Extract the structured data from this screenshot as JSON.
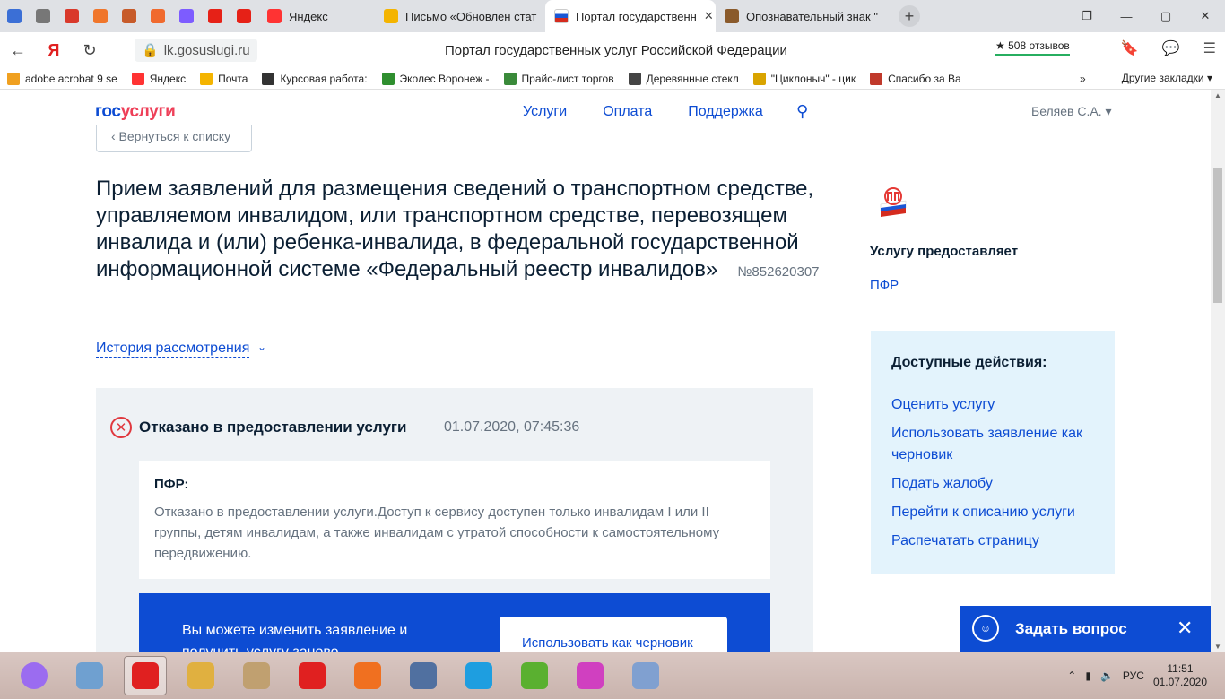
{
  "browser": {
    "tabs": [
      {
        "label": "Яндекс",
        "color": "#ff3333"
      },
      {
        "label": "Письмо «Обновлен стат",
        "color": "#f4b400"
      },
      {
        "label": "Портал государственн",
        "color": "#1a57d6",
        "active": true
      },
      {
        "label": "Опознавательный знак \"",
        "color": "#8a5a2b"
      }
    ],
    "pinned_colors": [
      "#3b6fd6",
      "#777777",
      "#d9392b",
      "#f0762b",
      "#c75b2a",
      "#f06a2e",
      "#7d5cff",
      "#e62117",
      "#e62117"
    ],
    "url": "lk.gosuslugi.ru",
    "page_title": "Портал государственных услуг Российской Федерации",
    "reviews": "★ 508 отзывов",
    "bookmarks": [
      {
        "label": "adobe acrobat 9 se",
        "color": "#f0a020"
      },
      {
        "label": "Яндекс",
        "color": "#ff3333"
      },
      {
        "label": "Почта",
        "color": "#f4b400"
      },
      {
        "label": "Курсовая работа:",
        "color": "#333333"
      },
      {
        "label": "Эколес Воронеж -",
        "color": "#2f8f2f"
      },
      {
        "label": "Прайс-лист торгов",
        "color": "#3a8a3a"
      },
      {
        "label": "Деревянные стекл",
        "color": "#444444"
      },
      {
        "label": "\"Циклоныч\" - цик",
        "color": "#d9a400"
      },
      {
        "label": "Спасибо за Ва",
        "color": "#c0392b"
      }
    ],
    "bookmarks_more": "»",
    "other_bookmarks": "Другие закладки ▾"
  },
  "site": {
    "logo_a": "гос",
    "logo_b": "услуги",
    "nav": [
      "Услуги",
      "Оплата",
      "Поддержка"
    ],
    "user": "Беляев С.А. ▾"
  },
  "main": {
    "back": "‹  Вернуться к списку",
    "title": "Прием заявлений для размещения сведений о транспортном средстве, управляемом инвалидом, или транспортном средстве, перевозящем инвалида и (или) ребенка-инвалида, в федеральной государственной информационной системе «Федеральный реестр инвалидов»",
    "request_no": "№852620307",
    "history": "История рассмотрения",
    "status": "Отказано в предоставлении услуги",
    "status_date": "01.07.2020, 07:45:36",
    "card_header": "ПФР:",
    "card_text": "Отказано в предоставлении услуги.Доступ к сервису доступен только инвалидам I или II группы, детям инвалидам, а также инвалидам с утратой способности к самостоятельному передвижению.",
    "blue_text": "Вы можете изменить заявление и получить услугу заново",
    "draft_button": "Использовать как черновик"
  },
  "side": {
    "provider_header": "Услугу предоставляет",
    "provider": "ПФР",
    "actions_header": "Доступные действия:",
    "actions": [
      "Оценить услугу",
      "Использовать заявление как черновик",
      "Подать жалобу",
      "Перейти к описанию услуги",
      "Распечатать страницу"
    ]
  },
  "ask": {
    "label": "Задать вопрос"
  },
  "taskbar": {
    "icons": [
      "#9b6cf0",
      "#6fa0d0",
      "#e02020",
      "#e0b040",
      "#c0a070",
      "#e02020",
      "#f07020",
      "#5070a0",
      "#1e9ee0",
      "#5ab030",
      "#d040c0",
      "#80a0d0"
    ],
    "lang": "РУС",
    "time": "11:51",
    "date": "01.07.2020"
  }
}
